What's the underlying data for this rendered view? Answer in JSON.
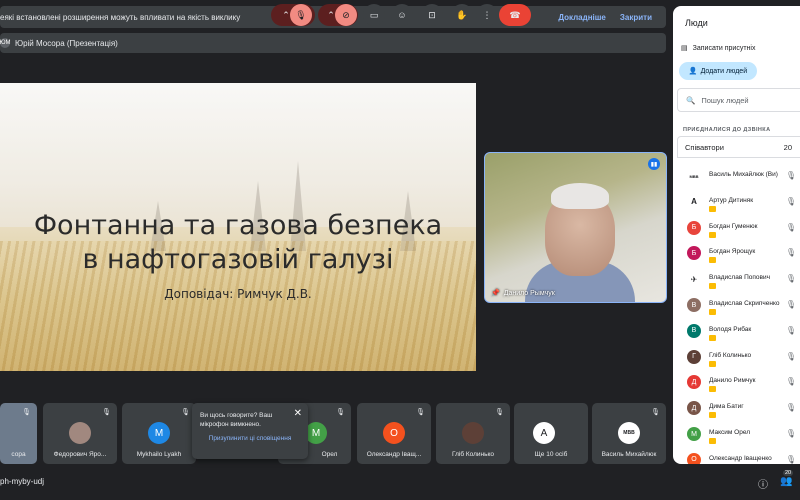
{
  "notification": {
    "message": "еякі встановлені розширення можуть впливати на якість виклику",
    "details_label": "Докладніше",
    "close_label": "Закрити"
  },
  "presenter_bar": {
    "initials": "ЮМ",
    "text": "Юрій Мосора (Презентація)"
  },
  "slide": {
    "title_line1": "Фонтанна та газова безпека",
    "title_line2": "в нафтогазовій галузі",
    "speaker": "Доповідач: Римчук Д.В."
  },
  "self_video": {
    "name": "Данило Рымчук"
  },
  "thumbnails": [
    {
      "name": "сора"
    },
    {
      "name": "Федорович Яро..."
    },
    {
      "name": "Mykhailo Lyakh",
      "initial": "M"
    },
    {
      "name": "Орел",
      "initial": "М"
    },
    {
      "name": "Олександр Іващ...",
      "initial": "О"
    },
    {
      "name": "Гліб Колинько"
    },
    {
      "name": "Ще 10 осіб",
      "initial": "А"
    },
    {
      "name": "Василь Михайлюк",
      "logo": "МВВ"
    }
  ],
  "toast": {
    "text": "Ви щось говорите? Ваш мікрофон вимкнено.",
    "action": "Призупинити ці сповіщення"
  },
  "toolbar": {
    "meeting_code": "ph-myby-udj",
    "participants_count": "20"
  },
  "panel": {
    "title": "Люди",
    "record_label": "Записати присутніх",
    "add_label": "Додати людей",
    "search_placeholder": "Пошук людей",
    "section_label": "ПРИЄДНАЛИСЯ ДО ДЗВІНКА",
    "group_label": "Співавтори",
    "group_count": "20",
    "people": [
      {
        "name": "Василь Михайлюк (Ви)",
        "initial": "МВВ",
        "color": "#ffffff"
      },
      {
        "name": "Артур Дитиняк",
        "initial": "А",
        "color": "#ffffff"
      },
      {
        "name": "Богдан Гуменюк",
        "initial": "Б",
        "color": "#e8453c"
      },
      {
        "name": "Богдан Ярощук",
        "initial": "Б",
        "color": "#c2185b"
      },
      {
        "name": "Владислав Попович",
        "initial": "✈",
        "color": "#ffffff"
      },
      {
        "name": "Владислав Скрипченко",
        "initial": "В",
        "color": "#8d6e63"
      },
      {
        "name": "Володя Рибак",
        "initial": "В",
        "color": "#00796b"
      },
      {
        "name": "Гліб Колинько",
        "initial": "Г",
        "color": "#5d4037"
      },
      {
        "name": "Данило Римчук",
        "initial": "Д",
        "color": "#e53935"
      },
      {
        "name": "Дима Батиг",
        "initial": "Д",
        "color": "#795548"
      },
      {
        "name": "Максим Орел",
        "initial": "М",
        "color": "#43a047"
      },
      {
        "name": "Олександр Іващенко",
        "initial": "О",
        "color": "#f4511e"
      }
    ]
  }
}
